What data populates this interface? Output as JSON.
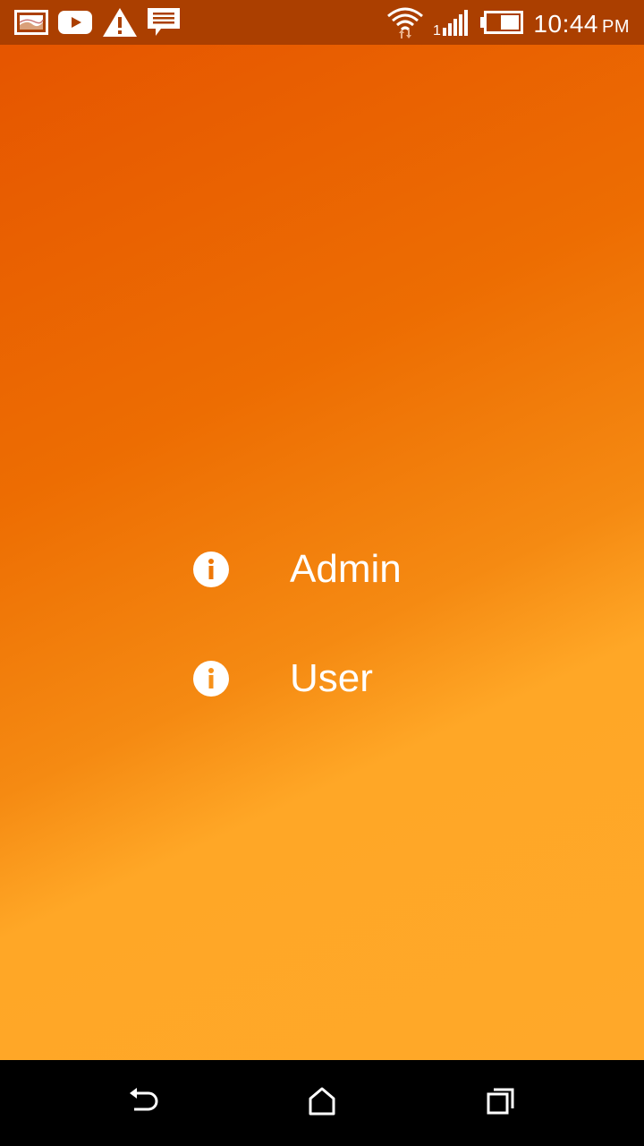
{
  "status_bar": {
    "time": "10:44",
    "ampm": "PM",
    "icons": [
      "image-notification-icon",
      "youtube-icon",
      "warning-icon",
      "message-icon",
      "wifi-icon",
      "signal-icon",
      "battery-icon"
    ],
    "sim_slot": "1"
  },
  "menu": {
    "items": [
      {
        "label": "Admin",
        "icon": "info-icon"
      },
      {
        "label": "User",
        "icon": "info-icon"
      }
    ]
  },
  "nav_bar": {
    "buttons": [
      "back-icon",
      "home-icon",
      "recents-icon"
    ]
  },
  "colors": {
    "status_bar": "#ab3f00",
    "gradient_start": "#e55300",
    "gradient_end": "#ffa82a",
    "text": "#ffffff",
    "nav_bar": "#000000"
  }
}
